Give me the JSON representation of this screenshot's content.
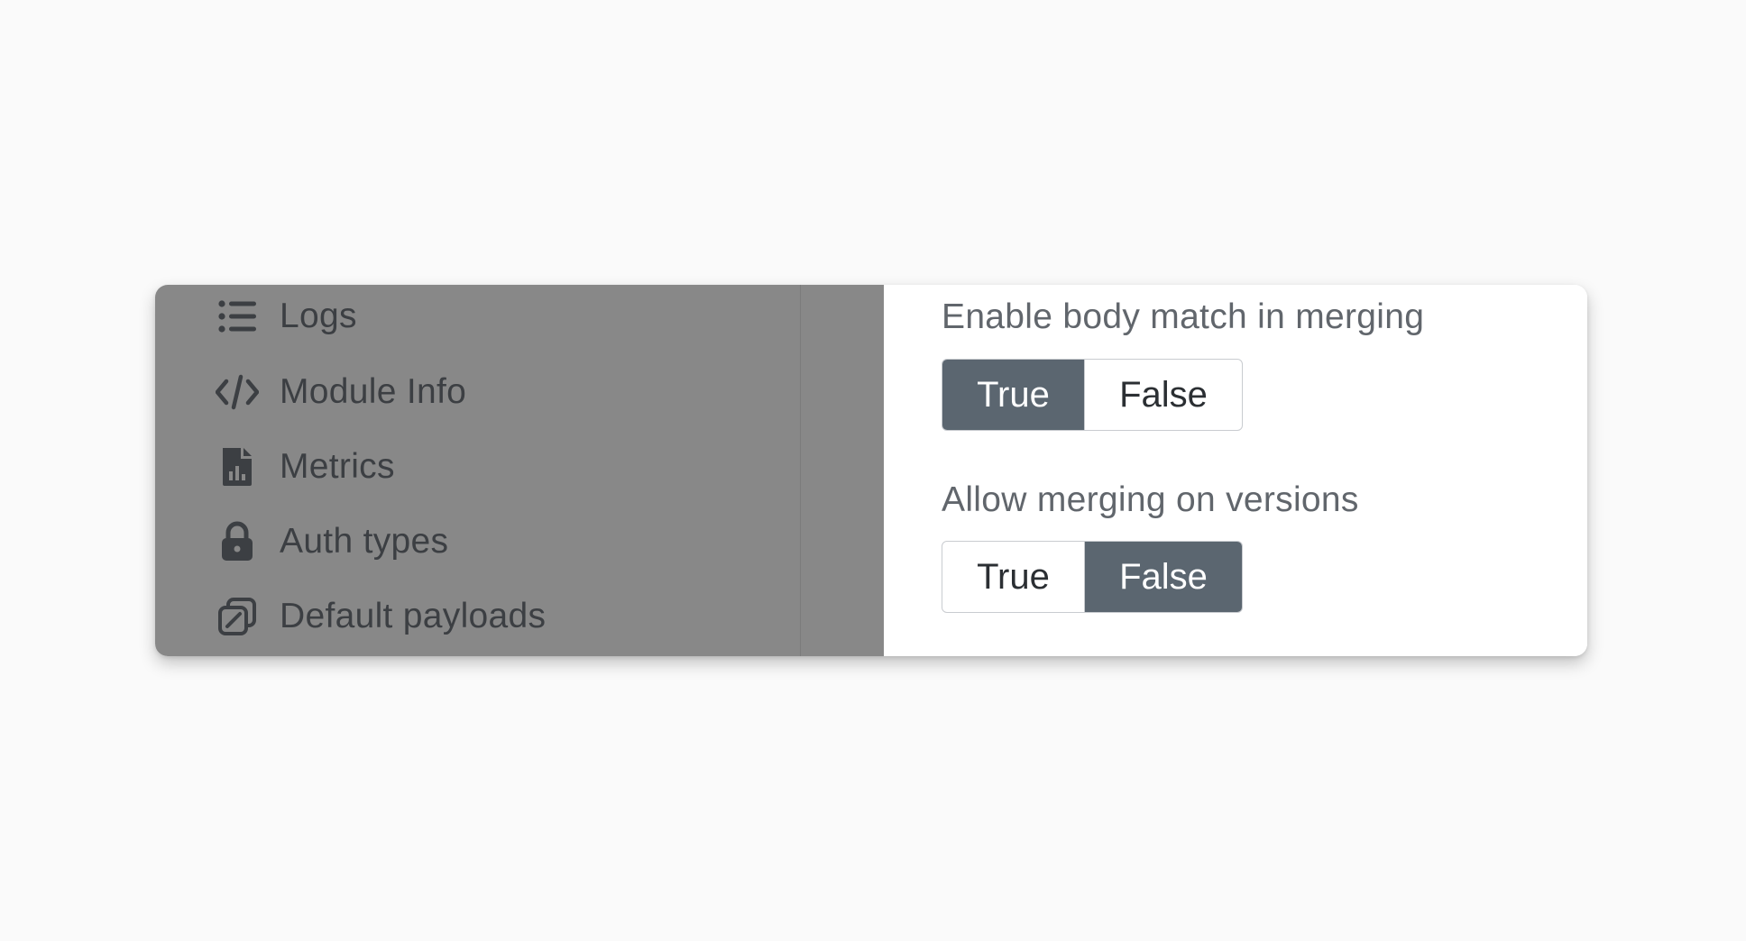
{
  "sidebar": {
    "items": [
      {
        "label": "Logs",
        "icon": "list-icon"
      },
      {
        "label": "Module Info",
        "icon": "code-icon"
      },
      {
        "label": "Metrics",
        "icon": "file-chart-icon"
      },
      {
        "label": "Auth types",
        "icon": "lock-icon"
      },
      {
        "label": "Default payloads",
        "icon": "payload-icon"
      }
    ]
  },
  "settings": {
    "body_match": {
      "label": "Enable body match in merging",
      "true_label": "True",
      "false_label": "False",
      "selected": "True"
    },
    "merge_versions": {
      "label": "Allow merging on versions",
      "true_label": "True",
      "false_label": "False",
      "selected": "False"
    }
  },
  "colors": {
    "overlay": "#888888",
    "active_toggle": "#5b6670",
    "background": "#fafafa"
  }
}
